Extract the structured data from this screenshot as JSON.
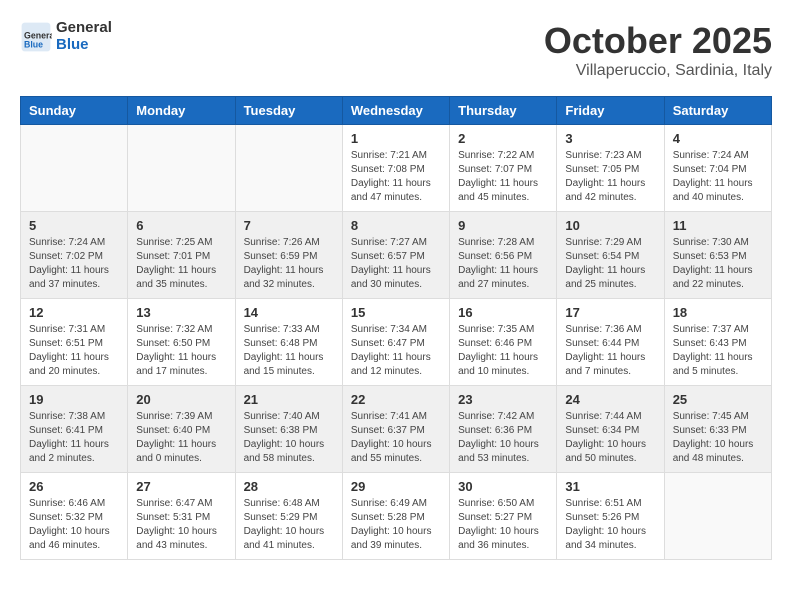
{
  "header": {
    "logo_general": "General",
    "logo_blue": "Blue",
    "month_title": "October 2025",
    "subtitle": "Villaperuccio, Sardinia, Italy"
  },
  "calendar": {
    "days_of_week": [
      "Sunday",
      "Monday",
      "Tuesday",
      "Wednesday",
      "Thursday",
      "Friday",
      "Saturday"
    ],
    "weeks": [
      [
        {
          "day": "",
          "info": ""
        },
        {
          "day": "",
          "info": ""
        },
        {
          "day": "",
          "info": ""
        },
        {
          "day": "1",
          "info": "Sunrise: 7:21 AM\nSunset: 7:08 PM\nDaylight: 11 hours\nand 47 minutes."
        },
        {
          "day": "2",
          "info": "Sunrise: 7:22 AM\nSunset: 7:07 PM\nDaylight: 11 hours\nand 45 minutes."
        },
        {
          "day": "3",
          "info": "Sunrise: 7:23 AM\nSunset: 7:05 PM\nDaylight: 11 hours\nand 42 minutes."
        },
        {
          "day": "4",
          "info": "Sunrise: 7:24 AM\nSunset: 7:04 PM\nDaylight: 11 hours\nand 40 minutes."
        }
      ],
      [
        {
          "day": "5",
          "info": "Sunrise: 7:24 AM\nSunset: 7:02 PM\nDaylight: 11 hours\nand 37 minutes."
        },
        {
          "day": "6",
          "info": "Sunrise: 7:25 AM\nSunset: 7:01 PM\nDaylight: 11 hours\nand 35 minutes."
        },
        {
          "day": "7",
          "info": "Sunrise: 7:26 AM\nSunset: 6:59 PM\nDaylight: 11 hours\nand 32 minutes."
        },
        {
          "day": "8",
          "info": "Sunrise: 7:27 AM\nSunset: 6:57 PM\nDaylight: 11 hours\nand 30 minutes."
        },
        {
          "day": "9",
          "info": "Sunrise: 7:28 AM\nSunset: 6:56 PM\nDaylight: 11 hours\nand 27 minutes."
        },
        {
          "day": "10",
          "info": "Sunrise: 7:29 AM\nSunset: 6:54 PM\nDaylight: 11 hours\nand 25 minutes."
        },
        {
          "day": "11",
          "info": "Sunrise: 7:30 AM\nSunset: 6:53 PM\nDaylight: 11 hours\nand 22 minutes."
        }
      ],
      [
        {
          "day": "12",
          "info": "Sunrise: 7:31 AM\nSunset: 6:51 PM\nDaylight: 11 hours\nand 20 minutes."
        },
        {
          "day": "13",
          "info": "Sunrise: 7:32 AM\nSunset: 6:50 PM\nDaylight: 11 hours\nand 17 minutes."
        },
        {
          "day": "14",
          "info": "Sunrise: 7:33 AM\nSunset: 6:48 PM\nDaylight: 11 hours\nand 15 minutes."
        },
        {
          "day": "15",
          "info": "Sunrise: 7:34 AM\nSunset: 6:47 PM\nDaylight: 11 hours\nand 12 minutes."
        },
        {
          "day": "16",
          "info": "Sunrise: 7:35 AM\nSunset: 6:46 PM\nDaylight: 11 hours\nand 10 minutes."
        },
        {
          "day": "17",
          "info": "Sunrise: 7:36 AM\nSunset: 6:44 PM\nDaylight: 11 hours\nand 7 minutes."
        },
        {
          "day": "18",
          "info": "Sunrise: 7:37 AM\nSunset: 6:43 PM\nDaylight: 11 hours\nand 5 minutes."
        }
      ],
      [
        {
          "day": "19",
          "info": "Sunrise: 7:38 AM\nSunset: 6:41 PM\nDaylight: 11 hours\nand 2 minutes."
        },
        {
          "day": "20",
          "info": "Sunrise: 7:39 AM\nSunset: 6:40 PM\nDaylight: 11 hours\nand 0 minutes."
        },
        {
          "day": "21",
          "info": "Sunrise: 7:40 AM\nSunset: 6:38 PM\nDaylight: 10 hours\nand 58 minutes."
        },
        {
          "day": "22",
          "info": "Sunrise: 7:41 AM\nSunset: 6:37 PM\nDaylight: 10 hours\nand 55 minutes."
        },
        {
          "day": "23",
          "info": "Sunrise: 7:42 AM\nSunset: 6:36 PM\nDaylight: 10 hours\nand 53 minutes."
        },
        {
          "day": "24",
          "info": "Sunrise: 7:44 AM\nSunset: 6:34 PM\nDaylight: 10 hours\nand 50 minutes."
        },
        {
          "day": "25",
          "info": "Sunrise: 7:45 AM\nSunset: 6:33 PM\nDaylight: 10 hours\nand 48 minutes."
        }
      ],
      [
        {
          "day": "26",
          "info": "Sunrise: 6:46 AM\nSunset: 5:32 PM\nDaylight: 10 hours\nand 46 minutes."
        },
        {
          "day": "27",
          "info": "Sunrise: 6:47 AM\nSunset: 5:31 PM\nDaylight: 10 hours\nand 43 minutes."
        },
        {
          "day": "28",
          "info": "Sunrise: 6:48 AM\nSunset: 5:29 PM\nDaylight: 10 hours\nand 41 minutes."
        },
        {
          "day": "29",
          "info": "Sunrise: 6:49 AM\nSunset: 5:28 PM\nDaylight: 10 hours\nand 39 minutes."
        },
        {
          "day": "30",
          "info": "Sunrise: 6:50 AM\nSunset: 5:27 PM\nDaylight: 10 hours\nand 36 minutes."
        },
        {
          "day": "31",
          "info": "Sunrise: 6:51 AM\nSunset: 5:26 PM\nDaylight: 10 hours\nand 34 minutes."
        },
        {
          "day": "",
          "info": ""
        }
      ]
    ]
  }
}
